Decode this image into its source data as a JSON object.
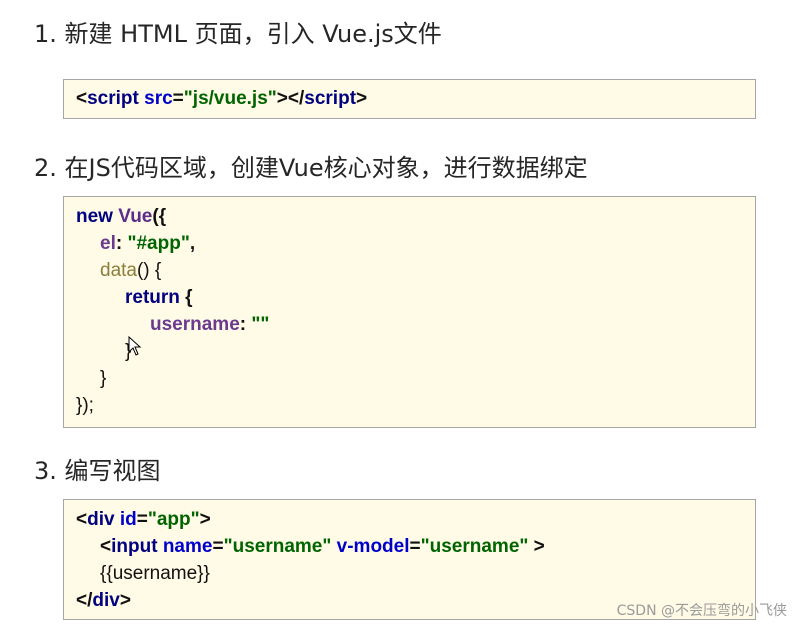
{
  "steps": [
    {
      "label": "1. 新建 HTML 页面，引入 Vue.js文件"
    },
    {
      "label": "2. 在JS代码区域，创建Vue核心对象，进行数据绑定"
    },
    {
      "label": "3. 编写视图"
    }
  ],
  "code1": {
    "lt": "<",
    "script_tag": "script",
    "src_attr": " src",
    "eq": "=",
    "src_value": "\"js/vue.js\"",
    "gt_close": "></",
    "script_tag2": "script",
    "gt": ">"
  },
  "code2": {
    "new_kw": "new",
    "vue_name": " Vue",
    "open": "({",
    "el_key": "el",
    "colon1": ": ",
    "el_value": "\"#app\"",
    "comma1": ",",
    "data_fn": "data",
    "data_rest": "() {",
    "return_kw": "return",
    "return_rest": " {",
    "username_key": "username",
    "colon2": ": ",
    "username_value": "\"\"",
    "close_inner": "}",
    "close_data": "}",
    "close_all": "});"
  },
  "code3": {
    "lt1": "<",
    "div_tag": "div",
    "id_attr": " id",
    "eq1": "=",
    "id_value": "\"app\"",
    "gt1": ">",
    "lt2": "<",
    "input_tag": "input",
    "name_attr": " name",
    "eq2": "=",
    "name_value": "\"username\"",
    "vmodel_attr": " v-model",
    "eq3": "=",
    "vmodel_value": "\"username\"",
    "gt2": " >",
    "mustache": "{{username}}",
    "close_lt": "</",
    "div_tag2": "div",
    "close_gt": ">"
  },
  "watermark": "CSDN @不会压弯的小飞侠",
  "colors": {
    "box_background": "#fffbe6",
    "keyword": "#000080",
    "string": "#006400",
    "property": "#6b3a8f",
    "attribute": "#0000cc"
  }
}
